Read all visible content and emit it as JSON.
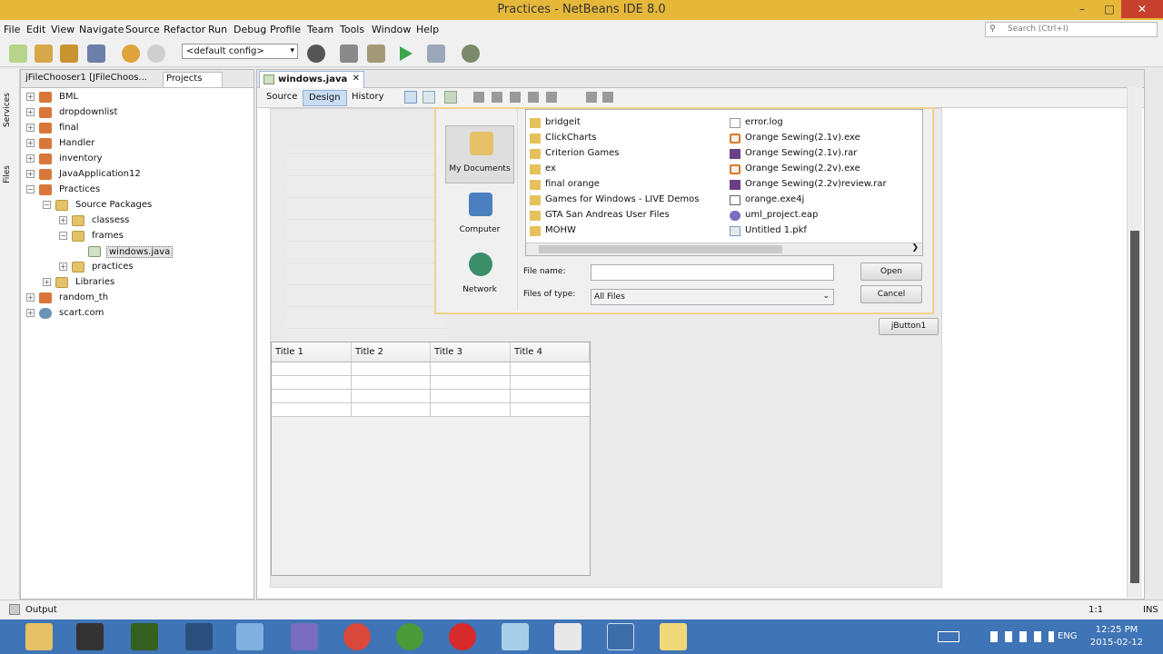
{
  "window": {
    "title": "Practices - NetBeans IDE 8.0",
    "minimize": "–",
    "maximize": "□",
    "close": "✕"
  },
  "menu": [
    "File",
    "Edit",
    "View",
    "Navigate",
    "Source",
    "Refactor",
    "Run",
    "Debug",
    "Profile",
    "Team",
    "Tools",
    "Window",
    "Help"
  ],
  "search": {
    "placeholder": "Search (Ctrl+I)"
  },
  "toolbar": {
    "config": "<default config>",
    "config_arrow": "▾"
  },
  "left_strip": {
    "services": "Services",
    "files": "Files"
  },
  "left_panel": {
    "tab_navigator": "jFileChooser1 [JFileChoos...",
    "tab_projects": "Projects",
    "tree": [
      {
        "label": "BML",
        "type": "project"
      },
      {
        "label": "dropdownlist",
        "type": "project"
      },
      {
        "label": "final",
        "type": "project"
      },
      {
        "label": "Handler",
        "type": "project"
      },
      {
        "label": "inventory",
        "type": "project"
      },
      {
        "label": "JavaApplication12",
        "type": "project"
      },
      {
        "label": "Practices",
        "type": "project"
      },
      {
        "label": "Source Packages",
        "type": "package"
      },
      {
        "label": "classess",
        "type": "package"
      },
      {
        "label": "frames",
        "type": "package"
      },
      {
        "label": "windows.java",
        "type": "file"
      },
      {
        "label": "practices",
        "type": "package"
      },
      {
        "label": "Libraries",
        "type": "package"
      },
      {
        "label": "random_th",
        "type": "project"
      },
      {
        "label": "scart.com",
        "type": "globe"
      }
    ]
  },
  "editor": {
    "tab": "windows.java",
    "tab_close": "✕",
    "views": [
      "Source",
      "Design",
      "History"
    ],
    "active_view": "Design"
  },
  "file_chooser": {
    "places": [
      "My Documents",
      "Computer",
      "Network"
    ],
    "files_left": [
      "bridgeit",
      "ClickCharts",
      "Criterion Games",
      "ex",
      "final orange",
      "Games for Windows - LIVE Demos",
      "GTA San Andreas User Files",
      "MOHW"
    ],
    "files_right": [
      {
        "name": "error.log",
        "type": "doc"
      },
      {
        "name": "Orange Sewing(2.1v).exe",
        "type": "exe"
      },
      {
        "name": "Orange Sewing(2.1v).rar",
        "type": "rar"
      },
      {
        "name": "Orange Sewing(2.2v).exe",
        "type": "exe"
      },
      {
        "name": "Orange Sewing(2.2v)review.rar",
        "type": "rar"
      },
      {
        "name": "orange.exe4j",
        "type": "j4"
      },
      {
        "name": "uml_project.eap",
        "type": "eap"
      },
      {
        "name": "Untitled 1.pkf",
        "type": "pkf"
      }
    ],
    "file_name_label": "File name:",
    "file_name_value": "",
    "files_of_type_label": "Files of type:",
    "files_of_type_value": "All Files",
    "dropdown_arrow": "⌄",
    "open_label": "Open",
    "cancel_label": "Cancel"
  },
  "button1": "jButton1",
  "table": {
    "headers": [
      "Title 1",
      "Title 2",
      "Title 3",
      "Title 4"
    ],
    "rows": 4
  },
  "status": {
    "output": "Output",
    "position": "1:1",
    "mode": "INS"
  },
  "clock": {
    "time": "12:25 PM",
    "date": "2015-02-12",
    "lang": "ENG"
  }
}
